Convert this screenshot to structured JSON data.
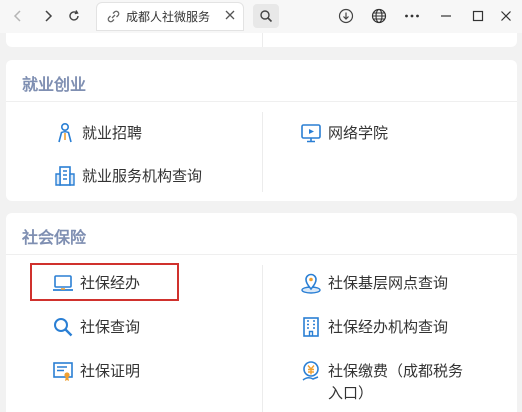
{
  "browser": {
    "tab_title": "成都人社微服务"
  },
  "sections": {
    "job": {
      "title": "就业创业",
      "items": [
        {
          "label": "就业招聘",
          "icon": "person-icon"
        },
        {
          "label": "网络学院",
          "icon": "video-screen-icon"
        },
        {
          "label": "就业服务机构查询",
          "icon": "building-icon"
        }
      ]
    },
    "social": {
      "title": "社会保险",
      "items": [
        {
          "label": "社保经办",
          "icon": "laptop-icon"
        },
        {
          "label": "社保基层网点查询",
          "icon": "location-pin-icon"
        },
        {
          "label": "社保查询",
          "icon": "magnifier-icon"
        },
        {
          "label": "社保经办机构查询",
          "icon": "office-building-icon"
        },
        {
          "label": "社保证明",
          "icon": "certificate-icon"
        },
        {
          "label": "社保缴费（成都税务",
          "label2": "入口）",
          "icon": "payment-icon"
        }
      ]
    }
  },
  "colors": {
    "accent": "#2a7fd4",
    "section_title": "#7f8fb2",
    "highlight": "#d0312d"
  }
}
